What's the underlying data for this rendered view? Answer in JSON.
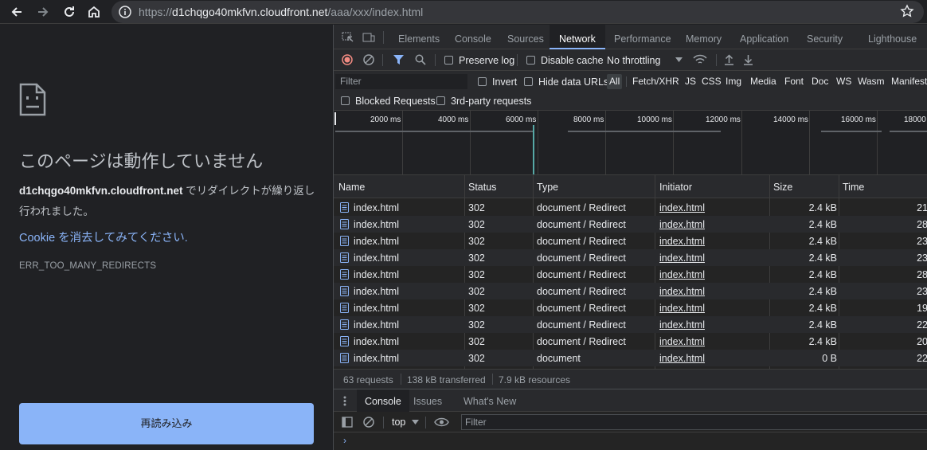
{
  "browser": {
    "url_scheme": "https://",
    "url_host": "d1chqgo40mkfvn.cloudfront.net",
    "url_path": "/aaa/xxx/index.html"
  },
  "error_page": {
    "title": "このページは動作していません",
    "host": "d1chqgo40mkfvn.cloudfront.net",
    "desc_rest": " でリダイレクトが繰り返し行われました。",
    "hint_link": "Cookie",
    "hint_rest": " を消去してみてください.",
    "code": "ERR_TOO_MANY_REDIRECTS",
    "reload_label": "再読み込み"
  },
  "devtools": {
    "tabs": [
      "Elements",
      "Console",
      "Sources",
      "Network",
      "Performance",
      "Memory",
      "Application",
      "Security",
      "Lighthouse"
    ],
    "active_tab": "Network",
    "toolbar": {
      "preserve_log": "Preserve log",
      "disable_cache": "Disable cache",
      "throttling": "No throttling"
    },
    "filter": {
      "placeholder": "Filter",
      "invert": "Invert",
      "hide_data_urls": "Hide data URLs",
      "types": [
        "All",
        "Fetch/XHR",
        "JS",
        "CSS",
        "Img",
        "Media",
        "Font",
        "Doc",
        "WS",
        "Wasm",
        "Manifest"
      ],
      "blocked_requests": "Blocked Requests",
      "third_party": "3rd-party requests"
    },
    "timeline_ticks": [
      "2000 ms",
      "4000 ms",
      "6000 ms",
      "8000 ms",
      "10000 ms",
      "12000 ms",
      "14000 ms",
      "16000 ms",
      "18000"
    ],
    "columns": [
      "Name",
      "Status",
      "Type",
      "Initiator",
      "Size",
      "Time"
    ],
    "rows": [
      {
        "name": "index.html",
        "status": "302",
        "type": "document / Redirect",
        "initiator": "index.html",
        "size": "2.4 kB",
        "time": "21"
      },
      {
        "name": "index.html",
        "status": "302",
        "type": "document / Redirect",
        "initiator": "index.html",
        "size": "2.4 kB",
        "time": "28"
      },
      {
        "name": "index.html",
        "status": "302",
        "type": "document / Redirect",
        "initiator": "index.html",
        "size": "2.4 kB",
        "time": "23"
      },
      {
        "name": "index.html",
        "status": "302",
        "type": "document / Redirect",
        "initiator": "index.html",
        "size": "2.4 kB",
        "time": "23"
      },
      {
        "name": "index.html",
        "status": "302",
        "type": "document / Redirect",
        "initiator": "index.html",
        "size": "2.4 kB",
        "time": "28"
      },
      {
        "name": "index.html",
        "status": "302",
        "type": "document / Redirect",
        "initiator": "index.html",
        "size": "2.4 kB",
        "time": "23"
      },
      {
        "name": "index.html",
        "status": "302",
        "type": "document / Redirect",
        "initiator": "index.html",
        "size": "2.4 kB",
        "time": "19"
      },
      {
        "name": "index.html",
        "status": "302",
        "type": "document / Redirect",
        "initiator": "index.html",
        "size": "2.4 kB",
        "time": "22"
      },
      {
        "name": "index.html",
        "status": "302",
        "type": "document / Redirect",
        "initiator": "index.html",
        "size": "2.4 kB",
        "time": "20"
      },
      {
        "name": "index.html",
        "status": "302",
        "type": "document",
        "initiator": "index.html",
        "size": "0 B",
        "time": "22"
      }
    ],
    "summary": {
      "requests": "63 requests",
      "transferred": "138 kB transferred",
      "resources": "7.9 kB resources"
    },
    "drawer": {
      "tabs": [
        "Console",
        "Issues",
        "What's New"
      ],
      "context": "top",
      "filter_placeholder": "Filter",
      "prompt": "›"
    }
  }
}
